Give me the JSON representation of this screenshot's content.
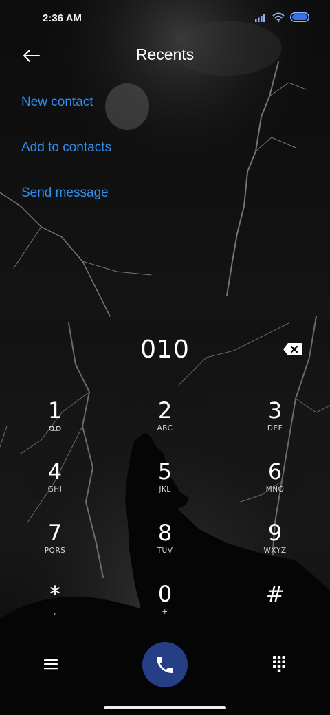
{
  "status_bar": {
    "time": "2:36 AM",
    "icons": [
      "signal-icon",
      "wifi-icon",
      "battery-icon"
    ]
  },
  "header": {
    "back_icon": "back-arrow-icon",
    "title": "Recents"
  },
  "actions": [
    {
      "label": "New contact"
    },
    {
      "label": "Add to contacts"
    },
    {
      "label": "Send message"
    }
  ],
  "dialer": {
    "number": "010",
    "backspace_icon": "backspace-icon"
  },
  "keypad": {
    "k1": {
      "digit": "1",
      "sub_icon": "voicemail-icon"
    },
    "k2": {
      "digit": "2",
      "letters": "ABC"
    },
    "k3": {
      "digit": "3",
      "letters": "DEF"
    },
    "k4": {
      "digit": "4",
      "letters": "GHI"
    },
    "k5": {
      "digit": "5",
      "letters": "JKL"
    },
    "k6": {
      "digit": "6",
      "letters": "MNO"
    },
    "k7": {
      "digit": "7",
      "letters": "PQRS"
    },
    "k8": {
      "digit": "8",
      "letters": "TUV"
    },
    "k9": {
      "digit": "9",
      "letters": "WXYZ"
    },
    "kstar": {
      "digit": "*",
      "letters": ","
    },
    "k0": {
      "digit": "0",
      "letters": "+"
    },
    "khash": {
      "digit": "#",
      "letters": ""
    }
  },
  "bottom_bar": {
    "menu_icon": "menu-icon",
    "call_icon": "phone-icon",
    "dialpad_icon": "dialpad-icon"
  },
  "colors": {
    "accent": "#2f8ff0",
    "call_button": "#263e86",
    "background": "#000000"
  }
}
